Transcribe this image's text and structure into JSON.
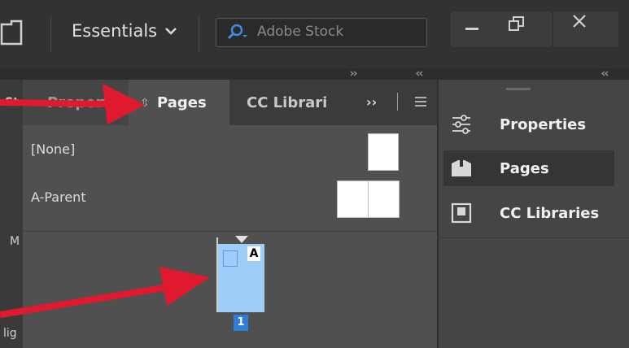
{
  "topbar": {
    "workspace_label": "Essentials",
    "search_placeholder": "Adobe Stock"
  },
  "panel": {
    "tabs": [
      {
        "label": "Propert",
        "state": "partially covered"
      },
      {
        "label": "Pages",
        "state": "active"
      },
      {
        "label": "CC Librari",
        "state": "truncated"
      }
    ],
    "more_label": "››",
    "parents": [
      {
        "label": "[None]"
      },
      {
        "label": "A-Parent"
      }
    ],
    "page": {
      "number": "1",
      "parent_prefix": "A"
    }
  },
  "right_panel": {
    "items": [
      {
        "label": "Properties",
        "icon": "sliders-icon"
      },
      {
        "label": "Pages",
        "icon": "pages-icon",
        "active": true
      },
      {
        "label": "CC Libraries",
        "icon": "cc-libraries-icon"
      }
    ]
  },
  "left_edge_fragments": {
    "a": "St",
    "b": "M",
    "c": "lig"
  },
  "colors": {
    "annotation_arrow": "#e0192f",
    "page_selected": "#9fcdf7",
    "page_number_badge": "#2d7ed9"
  }
}
